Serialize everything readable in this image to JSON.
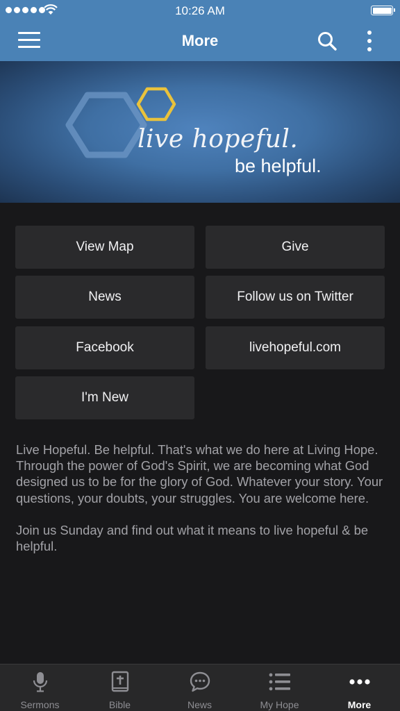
{
  "status_bar": {
    "time": "10:26 AM"
  },
  "nav": {
    "title": "More",
    "menu_icon": "hamburger-menu-icon",
    "search_icon": "search-icon",
    "overflow_icon": "vertical-dots-icon"
  },
  "banner": {
    "tagline_script": "live hopeful.",
    "tagline_plain": "be helpful.",
    "colors": {
      "hexagon_large": "#6f97c4",
      "hexagon_small": "#e9c23c",
      "background": "#4a7db5"
    }
  },
  "links": [
    {
      "label": "View Map"
    },
    {
      "label": "Give"
    },
    {
      "label": "News"
    },
    {
      "label": "Follow us on Twitter"
    },
    {
      "label": "Facebook"
    },
    {
      "label": "livehopeful.com"
    },
    {
      "label": "I'm New"
    }
  ],
  "about": {
    "paragraph1": "Live Hopeful. Be helpful. That's what we do here at Living Hope. Through the power of God's Spirit, we are becoming what God designed us to be for the glory of God. Whatever your story. Your questions, your doubts, your struggles. You are welcome here.",
    "paragraph2": "Join us Sunday and find out what it means to live hopeful & be helpful."
  },
  "tabs": [
    {
      "label": "Sermons",
      "icon": "microphone-icon"
    },
    {
      "label": "Bible",
      "icon": "bible-icon"
    },
    {
      "label": "News",
      "icon": "chat-bubble-icon"
    },
    {
      "label": "My Hope",
      "icon": "list-icon"
    },
    {
      "label": "More",
      "icon": "more-dots-icon",
      "active": true
    }
  ],
  "colors": {
    "accent": "#4a82b6",
    "background": "#18181a",
    "tile": "#2a2a2c",
    "body_text": "#a2a2a7"
  }
}
